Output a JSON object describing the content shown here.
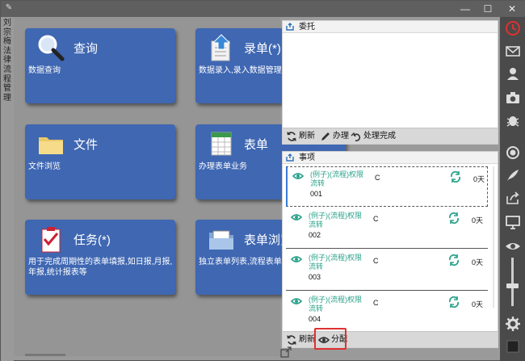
{
  "window": {
    "controls": {
      "minimize": "—",
      "maximize": "☐",
      "close": "✕"
    }
  },
  "side_title": [
    "刘",
    "宗",
    "梅",
    "法",
    "律",
    "流",
    "程",
    "管",
    "理"
  ],
  "tiles": [
    {
      "title": "查询",
      "desc": "数据查询",
      "icon": "magnifier-icon"
    },
    {
      "title": "录单(*)",
      "desc": "数据录入,录入数据管理",
      "icon": "upload-document-icon"
    },
    {
      "title": "文件",
      "desc": "文件浏览",
      "icon": "folder-icon"
    },
    {
      "title": "表单",
      "desc": "办理表单业务",
      "icon": "spreadsheet-icon"
    },
    {
      "title": "任务(*)",
      "desc": "用于完成周期性的表单填报,如日报,月报,年报,统计报表等",
      "icon": "checklist-icon"
    },
    {
      "title": "表单浏览",
      "desc": "独立表单列表,流程表单管",
      "icon": "folder-browse-icon"
    }
  ],
  "entrust_panel": {
    "title": "委托",
    "toolbar": {
      "refresh": "刷新",
      "handle": "办理",
      "done": "处理完成"
    }
  },
  "items_panel": {
    "title": "事项",
    "items": [
      {
        "name": "(例子)(流程)权限流转",
        "number": "001",
        "c": "C",
        "days": "0天"
      },
      {
        "name": "(例子)(流程)权限流转",
        "number": "002",
        "c": "C",
        "days": "0天"
      },
      {
        "name": "(例子)(流程)权限流转",
        "number": "003",
        "c": "C",
        "days": "0天"
      },
      {
        "name": "(例子)(流程)权限流转",
        "number": "004",
        "c": "C",
        "days": "0天"
      }
    ],
    "toolbar": {
      "refresh": "刷新",
      "assign": "分配"
    }
  },
  "right_toolbar": [
    "clock-icon",
    "mail-icon",
    "user-icon",
    "camera-icon",
    "bug-icon",
    "record-icon",
    "feather-icon",
    "share-icon",
    "monitor-icon",
    "eye-icon",
    "gear-icon"
  ],
  "colors": {
    "tile": "#3f67b2",
    "item_text": "#2aa28a",
    "highlight": "#e03030",
    "clock": "#e03030"
  }
}
